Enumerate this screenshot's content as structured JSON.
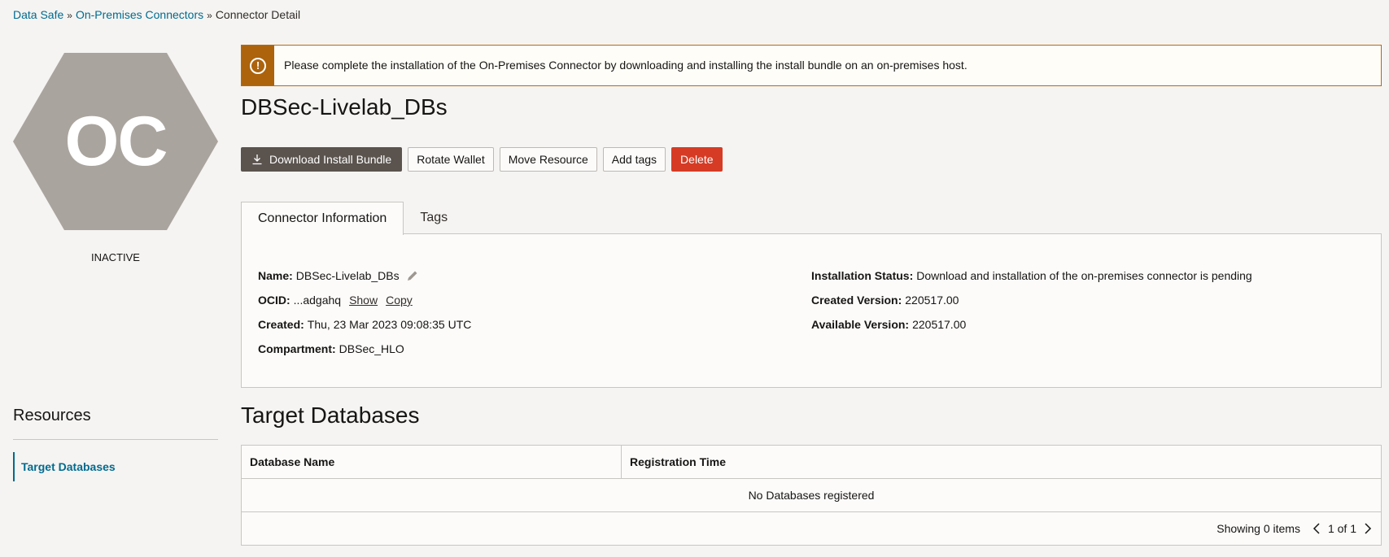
{
  "breadcrumb": {
    "items": [
      "Data Safe",
      "On-Premises Connectors",
      "Connector Detail"
    ],
    "separator": "»"
  },
  "resource_icon": {
    "initials": "OC",
    "color": "#aaa49e"
  },
  "status": "INACTIVE",
  "resources": {
    "title": "Resources",
    "items": [
      {
        "label": "Target Databases",
        "active": true
      }
    ]
  },
  "alert": {
    "icon": "warning-circle-icon",
    "message": "Please complete the installation of the On-Premises Connector by downloading and installing the install bundle on an on-premises host."
  },
  "title": "DBSec-Livelab_DBs",
  "actions": {
    "download": "Download Install Bundle",
    "rotate": "Rotate Wallet",
    "move": "Move Resource",
    "tags": "Add tags",
    "delete": "Delete"
  },
  "tabs": [
    {
      "label": "Connector Information",
      "active": true
    },
    {
      "label": "Tags",
      "active": false
    }
  ],
  "info": {
    "name_label": "Name:",
    "name_value": "DBSec-Livelab_DBs",
    "ocid_label": "OCID:",
    "ocid_value": "...adgahq",
    "ocid_show": "Show",
    "ocid_copy": "Copy",
    "created_label": "Created:",
    "created_value": "Thu, 23 Mar 2023 09:08:35 UTC",
    "compartment_label": "Compartment:",
    "compartment_value": "DBSec_HLO",
    "install_status_label": "Installation Status:",
    "install_status_value": "Download and installation of the on-premises connector is pending",
    "created_version_label": "Created Version:",
    "created_version_value": "220517.00",
    "available_version_label": "Available Version:",
    "available_version_value": "220517.00"
  },
  "target_databases": {
    "title": "Target Databases",
    "columns": [
      "Database Name",
      "Registration Time"
    ],
    "empty_message": "No Databases registered",
    "showing": "Showing 0 items",
    "page": "1 of 1"
  },
  "colors": {
    "link": "#006b8f",
    "alert_accent": "#ac630c",
    "primary_button": "#5a534e",
    "danger_button": "#d63b25"
  }
}
